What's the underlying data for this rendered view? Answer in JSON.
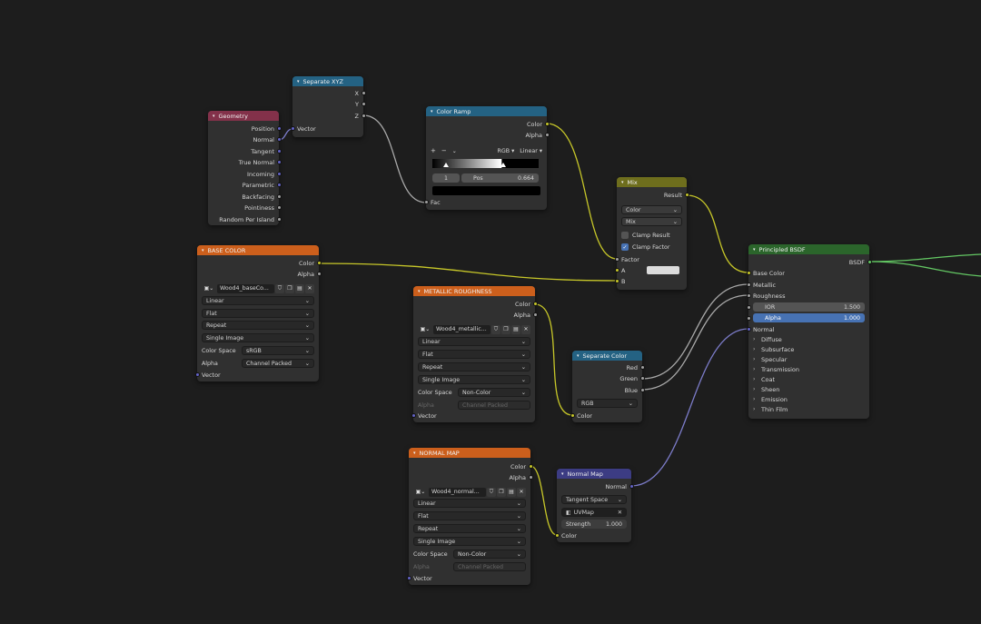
{
  "colors": {
    "canvas_bg": "#1d1d1d",
    "node_body": "#303030",
    "hdr_input": "#83314a",
    "hdr_converter": "#246283",
    "hdr_texture": "#cc5f1c",
    "hdr_color": "#6e6e1d",
    "hdr_vector": "#3c3c83",
    "hdr_shader": "#2b652b",
    "socket_color": "#c7c729",
    "socket_float": "#a1a1a1",
    "socket_vector": "#6363c7",
    "socket_shader": "#63c763"
  },
  "icons": [
    "chevron-down-icon",
    "image-icon",
    "shield-icon",
    "duplicate-icon",
    "folder-icon",
    "close-icon",
    "plus-icon",
    "minus-icon",
    "chevron-right-icon",
    "checkmark-icon"
  ],
  "geometry": {
    "title": "Geometry",
    "outputs": [
      "Position",
      "Normal",
      "Tangent",
      "True Normal",
      "Incoming",
      "Parametric",
      "Backfacing",
      "Pointiness",
      "Random Per Island"
    ]
  },
  "separate_xyz": {
    "title": "Separate XYZ",
    "outputs": [
      "X",
      "Y",
      "Z"
    ],
    "input": "Vector"
  },
  "color_ramp": {
    "title": "Color Ramp",
    "outputs": [
      "Color",
      "Alpha"
    ],
    "add": "+",
    "remove": "−",
    "more": "⌄",
    "color_mode": "RGB",
    "interpolation": "Linear",
    "stop_index": "1",
    "pos_label": "Pos",
    "pos_value": "0.664",
    "input": "Fac"
  },
  "mix": {
    "title": "Mix",
    "output": "Result",
    "data_type": "Color",
    "blend_mode": "Mix",
    "clamp_result": "Clamp Result",
    "clamp_result_on": false,
    "clamp_factor": "Clamp Factor",
    "clamp_factor_on": true,
    "inputs": [
      "Factor",
      "A",
      "B"
    ]
  },
  "base_color": {
    "title": "BASE COLOR",
    "outputs": [
      "Color",
      "Alpha"
    ],
    "image": "Wood4_baseCo...",
    "interpolation": "Linear",
    "projection": "Flat",
    "extension": "Repeat",
    "source": "Single Image",
    "color_space_label": "Color Space",
    "color_space": "sRGB",
    "alpha_label": "Alpha",
    "alpha": "Channel Packed",
    "input": "Vector"
  },
  "metallic_roughness": {
    "title": "METALLIC ROUGHNESS",
    "outputs": [
      "Color",
      "Alpha"
    ],
    "image": "Wood4_metallic...",
    "interpolation": "Linear",
    "projection": "Flat",
    "extension": "Repeat",
    "source": "Single Image",
    "color_space_label": "Color Space",
    "color_space": "Non-Color",
    "alpha_label": "Alpha",
    "alpha": "Channel Packed",
    "input": "Vector"
  },
  "separate_color": {
    "title": "Separate Color",
    "outputs": [
      "Red",
      "Green",
      "Blue"
    ],
    "mode": "RGB",
    "input": "Color"
  },
  "normal_map_tex": {
    "title": "NORMAL MAP",
    "outputs": [
      "Color",
      "Alpha"
    ],
    "image": "Wood4_normal...",
    "interpolation": "Linear",
    "projection": "Flat",
    "extension": "Repeat",
    "source": "Single Image",
    "color_space_label": "Color Space",
    "color_space": "Non-Color",
    "alpha_label": "Alpha",
    "alpha": "Channel Packed",
    "input": "Vector"
  },
  "normal_map": {
    "title": "Normal Map",
    "output": "Normal",
    "space": "Tangent Space",
    "uvmap": "UVMap",
    "strength_label": "Strength",
    "strength": "1.000",
    "input": "Color"
  },
  "principled": {
    "title": "Principled BSDF",
    "output": "BSDF",
    "inputs": [
      "Base Color",
      "Metallic",
      "Roughness"
    ],
    "ior_label": "IOR",
    "ior": "1.500",
    "alpha_label": "Alpha",
    "alpha": "1.000",
    "normal": "Normal",
    "panels": [
      "Diffuse",
      "Subsurface",
      "Specular",
      "Transmission",
      "Coat",
      "Sheen",
      "Emission",
      "Thin Film"
    ]
  }
}
